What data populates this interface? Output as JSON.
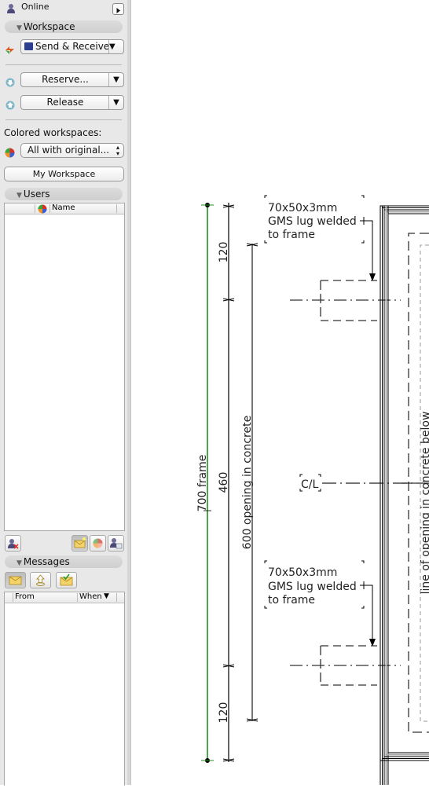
{
  "status": {
    "label": "Online"
  },
  "workspace": {
    "header": "Workspace",
    "send_receive_label": "Send & Receive",
    "reserve_label": "Reserve...",
    "release_label": "Release",
    "colored_label": "Colored workspaces:",
    "colored_select_value": "All with original...",
    "my_workspace_label": "My Workspace"
  },
  "users": {
    "header": "Users",
    "columns": [
      "Name"
    ]
  },
  "messages": {
    "header": "Messages",
    "columns": [
      "From",
      "When"
    ],
    "sort_indicator": "▼"
  },
  "drawing": {
    "annotation_top": [
      "70x50x3mm",
      "GMS lug welded",
      "to frame"
    ],
    "annotation_bottom": [
      "70x50x3mm",
      "GMS lug welded",
      "to frame"
    ],
    "dim_frame": "700 frame",
    "dim_top": "120",
    "dim_mid": "460",
    "dim_bottom": "120",
    "dim_opening": "600 opening in concrete",
    "centerline_label": "C/L",
    "opening_note": "line of opening in concrete below",
    "colors": {
      "frame_dim_line": "#1f8f1f",
      "line": "#000000",
      "dashed": "#555555"
    }
  }
}
